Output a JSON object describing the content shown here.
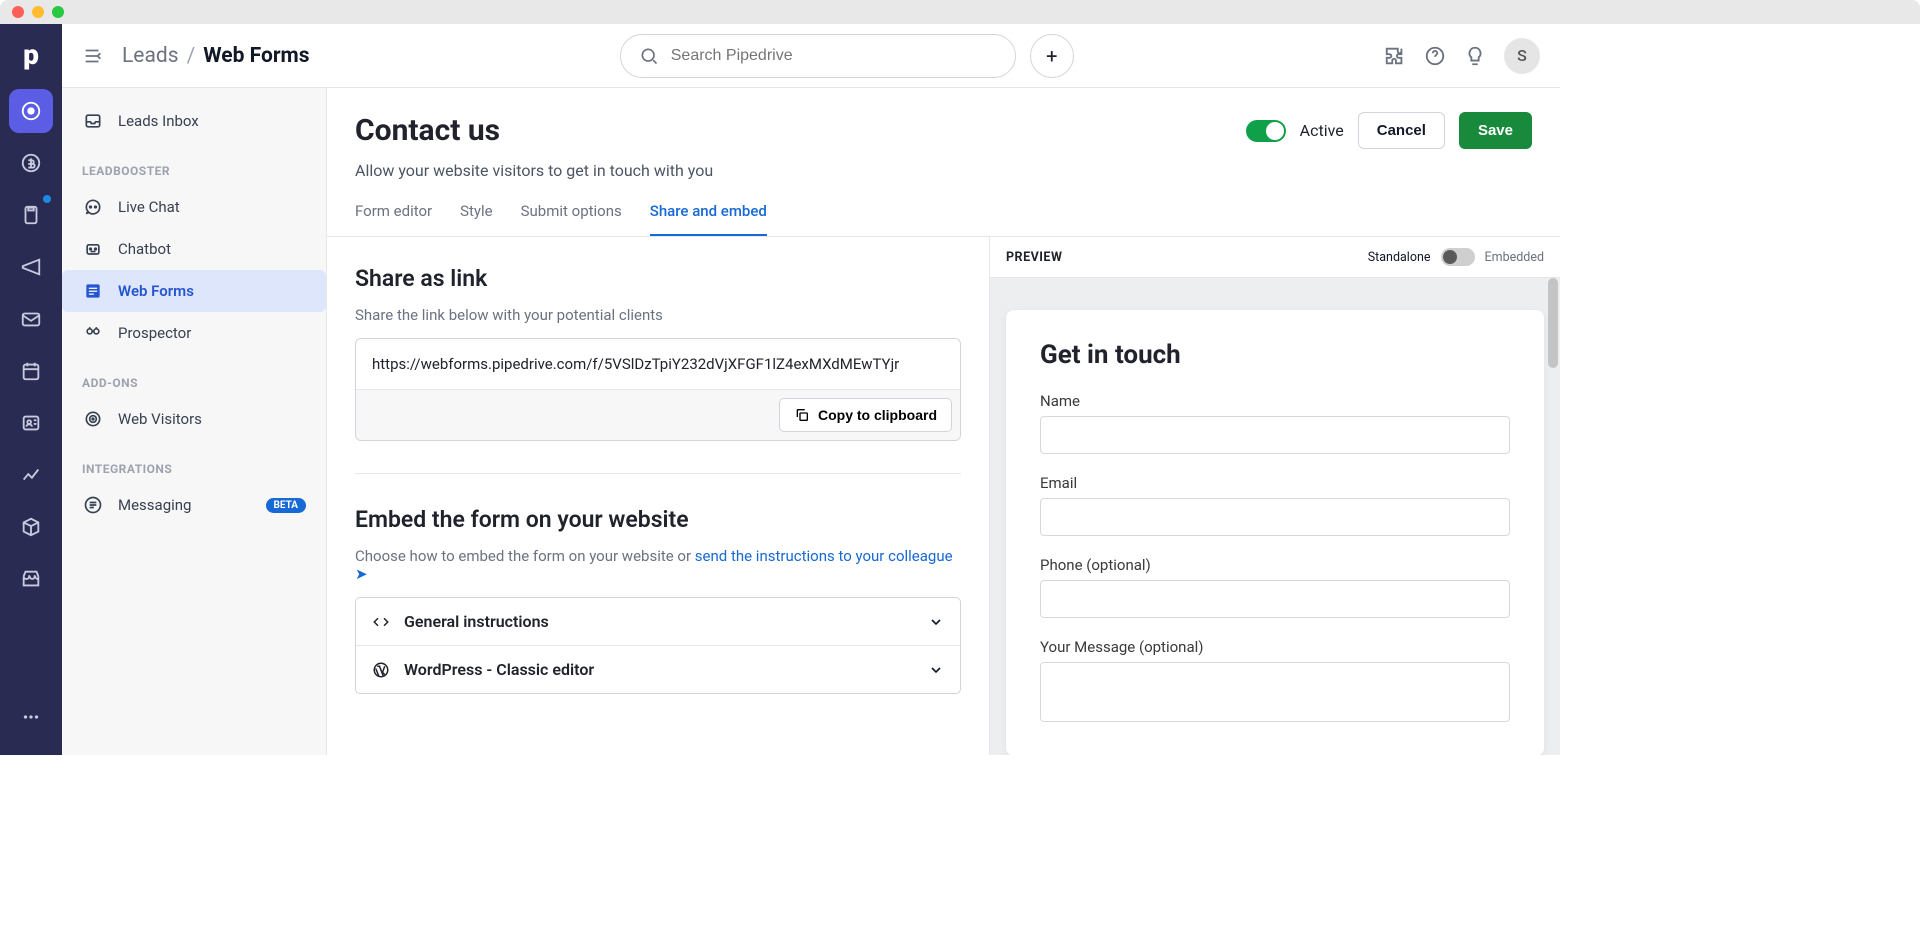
{
  "breadcrumb": {
    "parent": "Leads",
    "current": "Web Forms"
  },
  "search": {
    "placeholder": "Search Pipedrive"
  },
  "avatar_initial": "S",
  "sidebar": {
    "top_item": "Leads Inbox",
    "sections": [
      {
        "heading": "LEADBOOSTER",
        "items": [
          {
            "label": "Live Chat"
          },
          {
            "label": "Chatbot"
          },
          {
            "label": "Web Forms",
            "active": true
          },
          {
            "label": "Prospector"
          }
        ]
      },
      {
        "heading": "ADD-ONS",
        "items": [
          {
            "label": "Web Visitors"
          }
        ]
      },
      {
        "heading": "INTEGRATIONS",
        "items": [
          {
            "label": "Messaging",
            "badge": "BETA"
          }
        ]
      }
    ]
  },
  "page": {
    "title": "Contact us",
    "description": "Allow your website visitors to get in touch with you",
    "status_label": "Active",
    "cancel_label": "Cancel",
    "save_label": "Save"
  },
  "tabs": [
    {
      "label": "Form editor"
    },
    {
      "label": "Style"
    },
    {
      "label": "Submit options"
    },
    {
      "label": "Share and embed",
      "active": true
    }
  ],
  "share": {
    "title": "Share as link",
    "subtitle": "Share the link below with your potential clients",
    "url": "https://webforms.pipedrive.com/f/5VSlDzTpiY232dVjXFGF1lZ4exMXdMEwTYjr",
    "copy_label": "Copy to clipboard"
  },
  "embed": {
    "title": "Embed the form on your website",
    "subtitle_prefix": "Choose how to embed the form on your website or ",
    "link_text": "send the instructions to your colleague",
    "items": [
      {
        "label": "General instructions"
      },
      {
        "label": "WordPress - Classic editor"
      }
    ]
  },
  "preview": {
    "label": "PREVIEW",
    "mode_standalone": "Standalone",
    "mode_embedded": "Embedded",
    "form": {
      "title": "Get in touch",
      "fields": [
        {
          "label": "Name"
        },
        {
          "label": "Email"
        },
        {
          "label": "Phone (optional)"
        },
        {
          "label": "Your Message (optional)",
          "textarea": true
        }
      ]
    }
  }
}
